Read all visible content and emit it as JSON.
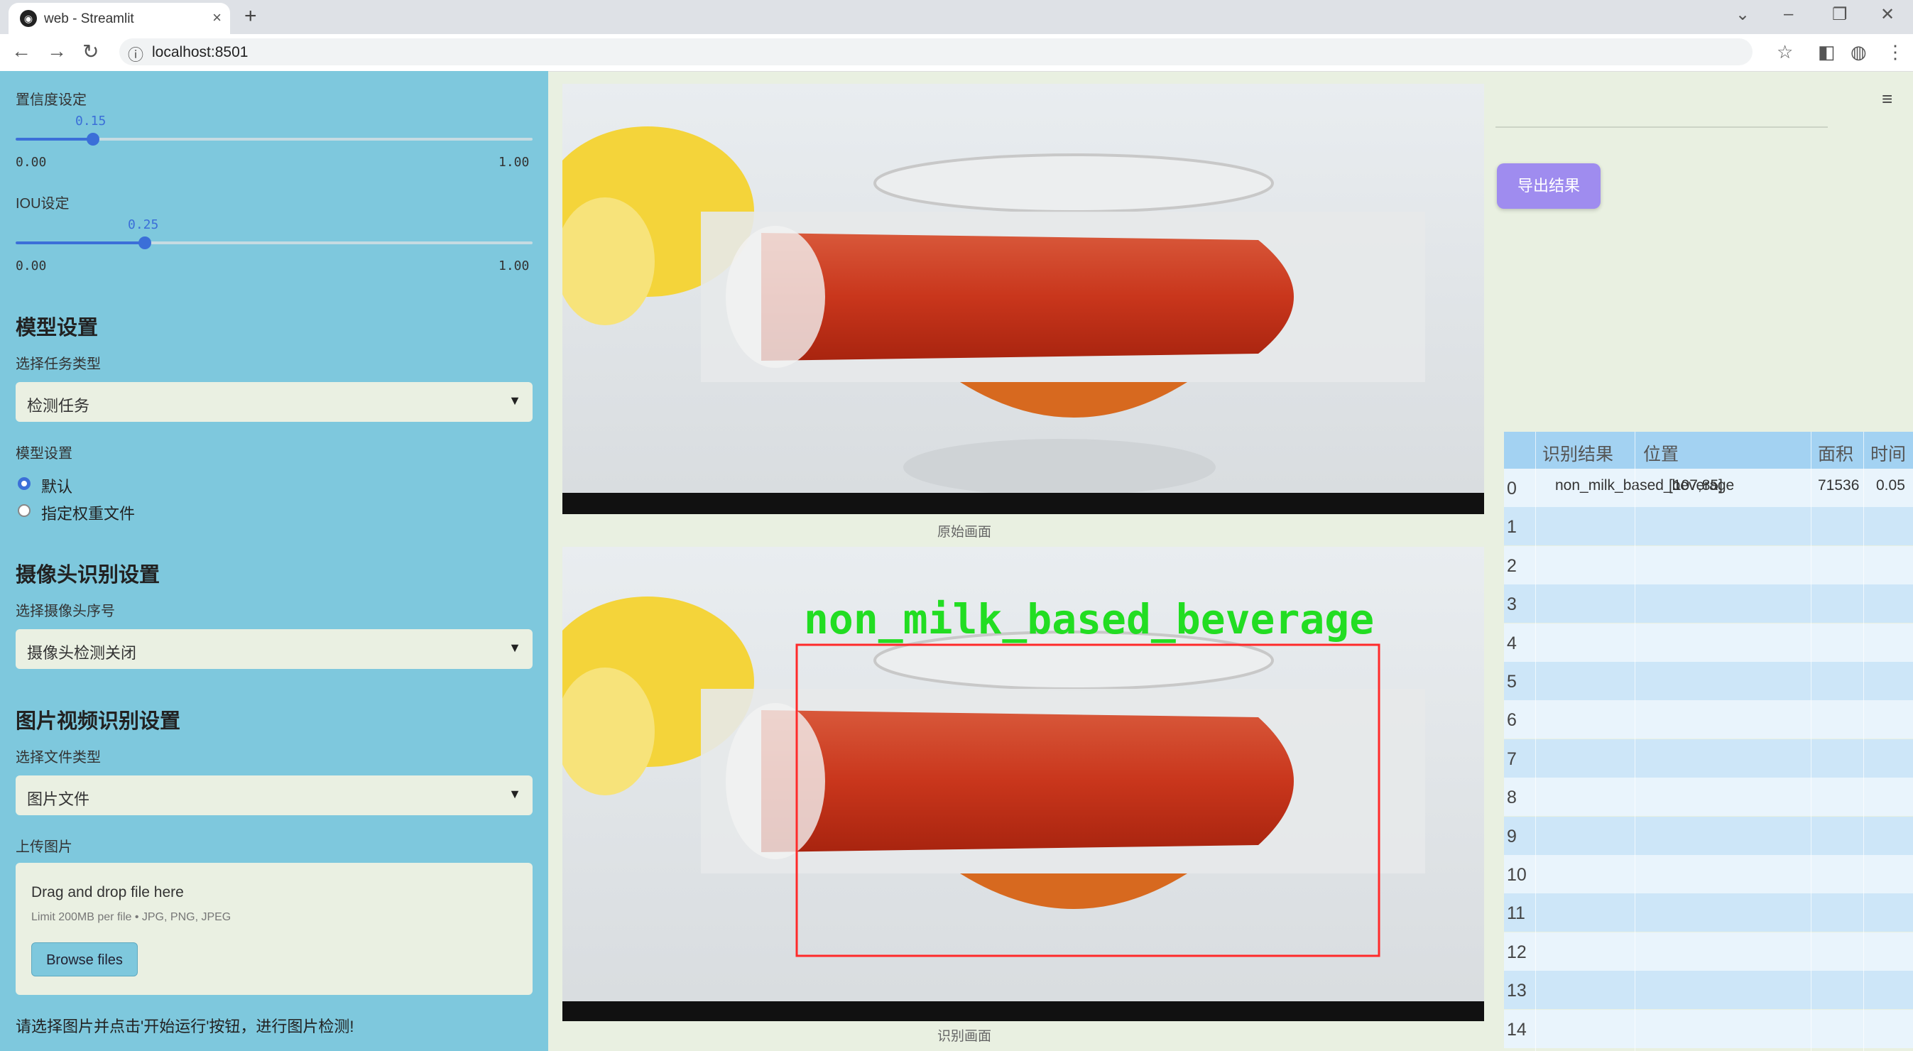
{
  "browser": {
    "tab_title": "web - Streamlit",
    "url": "localhost:8501"
  },
  "sidebar": {
    "confidence": {
      "label": "置信度设定",
      "value": "0.15",
      "fraction": 0.15,
      "min": "0.00",
      "max": "1.00"
    },
    "iou": {
      "label": "IOU设定",
      "value": "0.25",
      "fraction": 0.25,
      "min": "0.00",
      "max": "1.00"
    },
    "model_section": {
      "title": "模型设置",
      "task_label": "选择任务类型",
      "task_value": "检测任务",
      "weights_label": "模型设置",
      "options": [
        "默认",
        "指定权重文件"
      ],
      "selected": 0
    },
    "camera_section": {
      "title": "摄像头识别设置",
      "camera_label": "选择摄像头序号",
      "camera_value": "摄像头检测关闭"
    },
    "media_section": {
      "title": "图片视频识别设置",
      "file_type_label": "选择文件类型",
      "file_type_value": "图片文件",
      "upload_label": "上传图片",
      "drop_text": "Drag and drop file here",
      "limit_text": "Limit 200MB per file • JPG, PNG, JPEG",
      "browse_label": "Browse files"
    },
    "hint": "请选择图片并点击'开始运行'按钮，进行图片检测!"
  },
  "main": {
    "original_caption": "原始画面",
    "detected_caption": "识别画面",
    "detection_label": "non_milk_based_beverage",
    "export_label": "导出结果"
  },
  "results_table": {
    "headers": [
      "识别结果",
      "位置",
      "面积",
      "时间"
    ],
    "rows": [
      {
        "index": "0",
        "result": "non_milk_based_beverage",
        "position": "[107,85]",
        "area": "71536",
        "time": "0.05"
      },
      {
        "index": "1"
      },
      {
        "index": "2"
      },
      {
        "index": "3"
      },
      {
        "index": "4"
      },
      {
        "index": "5"
      },
      {
        "index": "6"
      },
      {
        "index": "7"
      },
      {
        "index": "8"
      },
      {
        "index": "9"
      },
      {
        "index": "10"
      },
      {
        "index": "11"
      },
      {
        "index": "12"
      },
      {
        "index": "13"
      },
      {
        "index": "14"
      }
    ]
  },
  "colors": {
    "sidebar_bg": "#7ec8dd",
    "main_bg": "#e9f0e1",
    "accent": "#3b6fd8",
    "export_btn": "#9f8cef",
    "detection_box": "#ff2a2a",
    "detection_text": "#22dd22"
  }
}
